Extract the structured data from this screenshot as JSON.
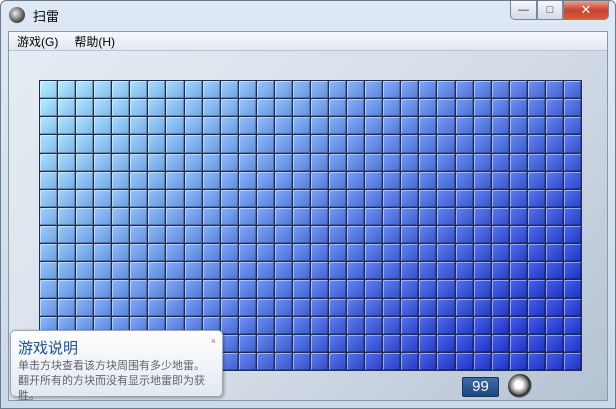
{
  "window": {
    "title": "扫雷",
    "minimize": "—",
    "maximize": "□",
    "close": "✕"
  },
  "menu": [
    {
      "label": "游戏(G)"
    },
    {
      "label": "帮助(H)"
    }
  ],
  "board": {
    "columns": 30,
    "rows": 16,
    "color_light": "#9fdaf8",
    "color_dark": "#2f45d3"
  },
  "status": {
    "mine_counter": "99"
  },
  "tooltip": {
    "title": "游戏说明",
    "body": "单击方块查看该方块周围有多少地雷。翻开所有的方块而没有显示地雷即为获胜。",
    "close": "×"
  }
}
